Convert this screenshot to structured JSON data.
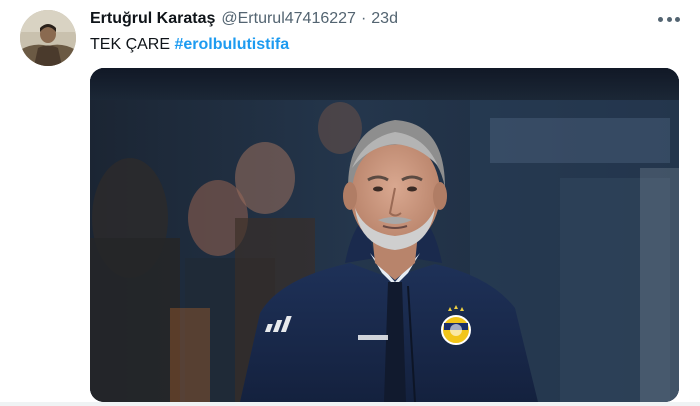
{
  "tweet": {
    "author": {
      "display_name": "Ertuğrul Karataş",
      "handle": "@Erturul47416227",
      "avatar_icon": "profile-photo"
    },
    "separator": "·",
    "timestamp": "23d",
    "text_prefix": "TEK ÇARE ",
    "hashtag": "#erolbulutistifa",
    "more_icon": "ellipsis-icon",
    "media_description_icon": "photo"
  },
  "colors": {
    "accent": "#1d9bf0",
    "text_primary": "#0f1419",
    "text_secondary": "#536471"
  }
}
